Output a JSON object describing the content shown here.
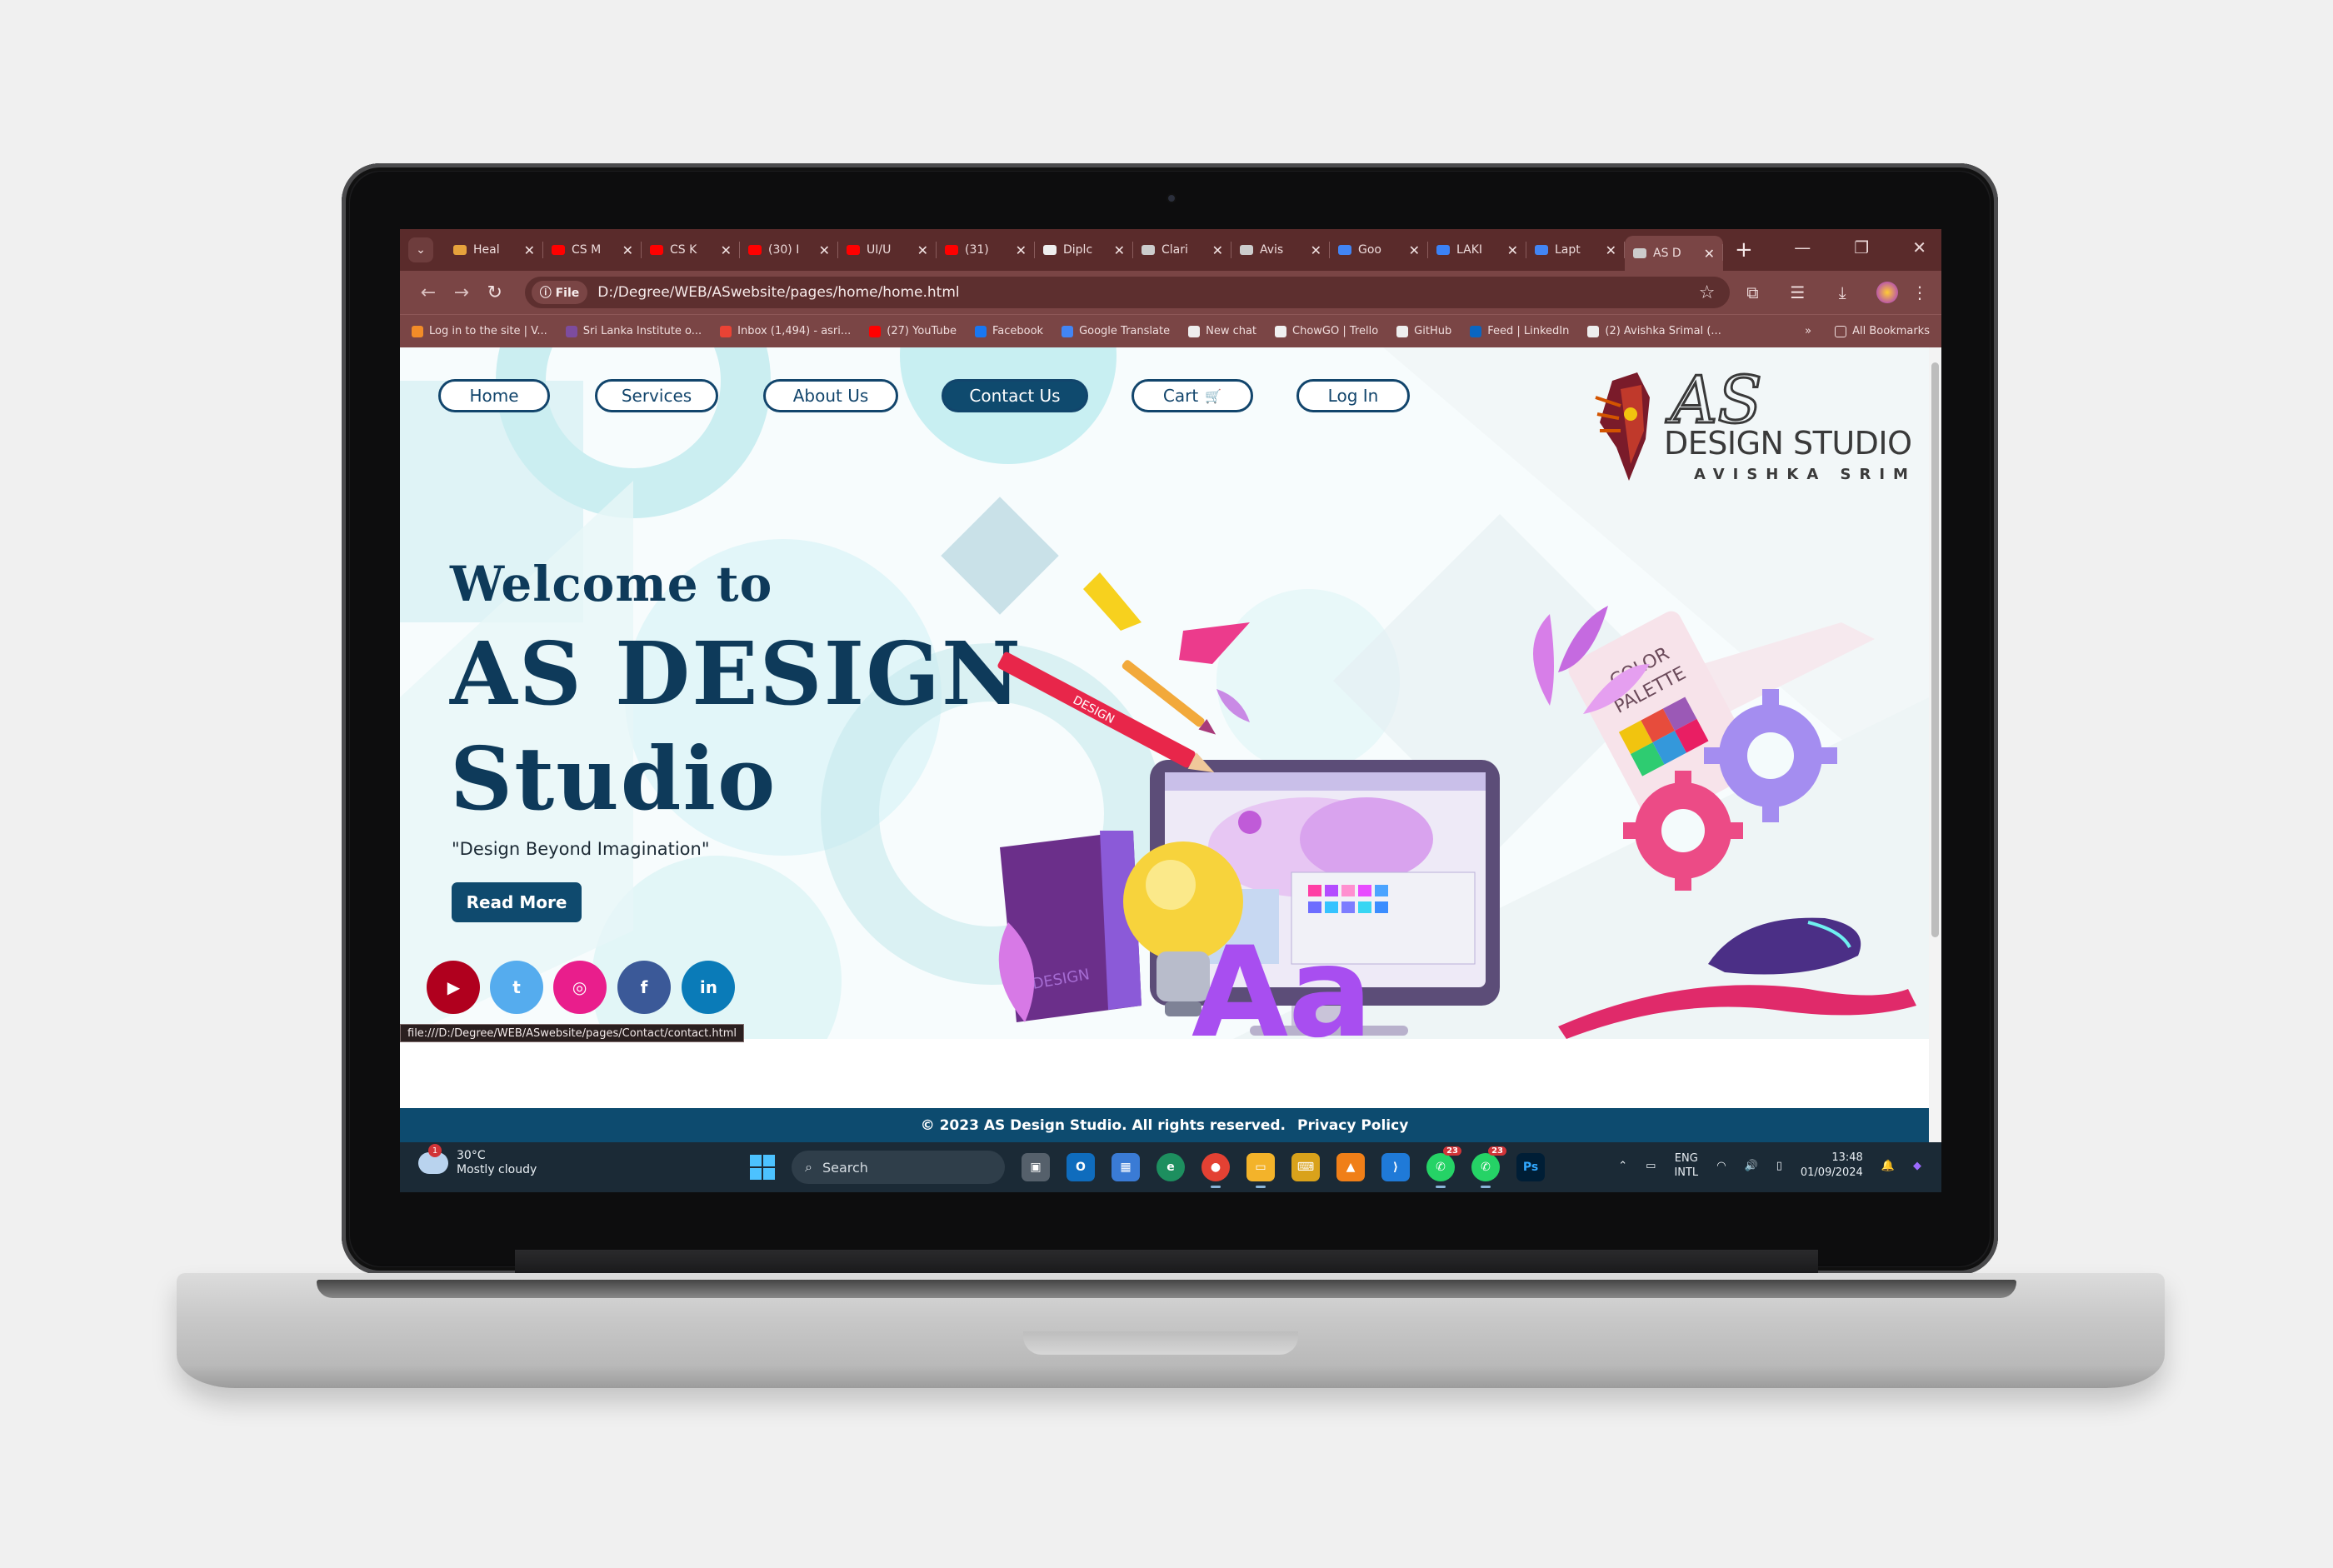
{
  "browser": {
    "tabs": [
      {
        "label": "Heal",
        "color": "#e6a23c"
      },
      {
        "label": "CS M",
        "color": "#ff0000"
      },
      {
        "label": "CS K",
        "color": "#ff0000"
      },
      {
        "label": "(30) I",
        "color": "#ff0000"
      },
      {
        "label": "UI/U",
        "color": "#ff0000"
      },
      {
        "label": "(31)",
        "color": "#ff0000"
      },
      {
        "label": "Diplc",
        "color": "#eeeeee"
      },
      {
        "label": "Clari",
        "color": "#cccccc"
      },
      {
        "label": "Avis",
        "color": "#cccccc"
      },
      {
        "label": "Goo",
        "color": "#4285f4"
      },
      {
        "label": "LAKI",
        "color": "#3b82f6"
      },
      {
        "label": "Lapt",
        "color": "#4285f4"
      },
      {
        "label": "AS D",
        "color": "#cccccc",
        "active": true
      }
    ],
    "url_scheme_chip": "File",
    "url": "D:/Degree/WEB/ASwebsite/pages/home/home.html",
    "bookmarks": [
      {
        "label": "Log in to the site | V...",
        "color": "#f28c28"
      },
      {
        "label": "Sri Lanka Institute o...",
        "color": "#7d4c9e"
      },
      {
        "label": "Inbox (1,494) - asri...",
        "color": "#ea4335"
      },
      {
        "label": "(27) YouTube",
        "color": "#ff0000"
      },
      {
        "label": "Facebook",
        "color": "#1877f2"
      },
      {
        "label": "Google Translate",
        "color": "#4285f4"
      },
      {
        "label": "New chat",
        "color": "#eeeeee"
      },
      {
        "label": "ChowGO | Trello",
        "color": "#f0f0f0"
      },
      {
        "label": "GitHub",
        "color": "#eeeeee"
      },
      {
        "label": "Feed | LinkedIn",
        "color": "#0a66c2"
      },
      {
        "label": "(2) Avishka Srimal (...",
        "color": "#eeeeee"
      }
    ],
    "bookmarks_overflow": "»",
    "all_bookmarks": "All Bookmarks"
  },
  "site": {
    "nav": {
      "home": "Home",
      "services": "Services",
      "about": "About Us",
      "contact": "Contact Us",
      "cart": "Cart",
      "login": "Log In"
    },
    "logo": {
      "mark": "AS",
      "name": "DESIGN STUDIO",
      "owner": "AVISHKA SRIMAL"
    },
    "hero": {
      "welcome": "Welcome to",
      "title_line1": "AS DESIGN",
      "title_line2": "Studio",
      "tagline": "\"Design Beyond Imagination\"",
      "cta": "Read More"
    },
    "social": [
      {
        "name": "youtube-icon",
        "glyph": "▶",
        "color": "#b0001e"
      },
      {
        "name": "twitter-icon",
        "glyph": "t",
        "color": "#55acee"
      },
      {
        "name": "instagram-icon",
        "glyph": "◎",
        "color": "#e91e8c"
      },
      {
        "name": "facebook-icon",
        "glyph": "f",
        "color": "#3b5998"
      },
      {
        "name": "linkedin-icon",
        "glyph": "in",
        "color": "#0a7bb8"
      }
    ],
    "illustration": {
      "palette_label_1": "COLOR",
      "palette_label_2": "PALETTE",
      "pencil_label": "DESIGN",
      "book_label": "DESIGN",
      "letters": "Aa"
    },
    "status_link": "file:///D:/Degree/WEB/ASwebsite/pages/Contact/contact.html",
    "footer": {
      "copyright": "© 2023 AS Design Studio. All rights reserved.",
      "privacy": "Privacy Policy"
    }
  },
  "taskbar": {
    "weather_badge": "1",
    "temperature": "30°C",
    "condition": "Mostly cloudy",
    "search_placeholder": "Search",
    "whatsapp_count": "23",
    "whatsapp2_count": "23",
    "language": "ENG",
    "layout": "INTL",
    "time": "13:48",
    "date": "01/09/2024"
  }
}
